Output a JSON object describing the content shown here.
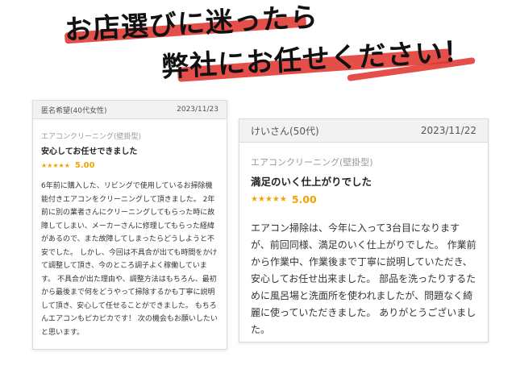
{
  "headline": {
    "line1": "お店選びに迷ったら",
    "line2": "弊社にお任せください！",
    "brush_color": "#e0302a"
  },
  "reviews": [
    {
      "author": "匿名希望(40代女性)",
      "date": "2023/11/23",
      "category": "エアコンクリーニング(壁掛型)",
      "title": "安心してお任せできました",
      "stars": "★★★★★",
      "score": "5.00",
      "rating_value": 5,
      "body": "6年前に購入した、リビングで使用しているお掃除機能付きエアコンをクリーニングして頂きました。 2年前に別の業者さんにクリーニングしてもらった時に故障してしまい、メーカーさんに修理してもらった経緯があるので、また故障してしまったらどうしようと不安でした。 しかし、今回は不具合が出ても時間をかけて調整して頂き、今のところ調子よく稼働しています。 不具合が出た理由や、調整方法はもちろん、最初から最後まで何をどうやって掃除するかも丁寧に説明して頂き、安心して任せることができました。 もちろんエアコンもピカピカです！ 次の機会もお願いしたいと思います。"
    },
    {
      "author": "けいさん(50代)",
      "date": "2023/11/22",
      "category": "エアコンクリーニング(壁掛型)",
      "title": "満足のいく仕上がりでした",
      "stars": "★★★★★",
      "score": "5.00",
      "rating_value": 5,
      "body": "エアコン掃除は、今年に入って3台目になりますが、前回同様、満足のいく仕上がりでした。 作業前から作業中、作業後まで丁寧に説明していただき、安心してお任せ出来ました。 部品を洗ったりするために風呂場と洗面所を使われましたが、問題なく綺麗に使っていただきました。 ありがとうございました。"
    }
  ],
  "colors": {
    "star": "#f0a500",
    "header_bg": "#f2f2f2",
    "border": "#dcdcdc"
  }
}
